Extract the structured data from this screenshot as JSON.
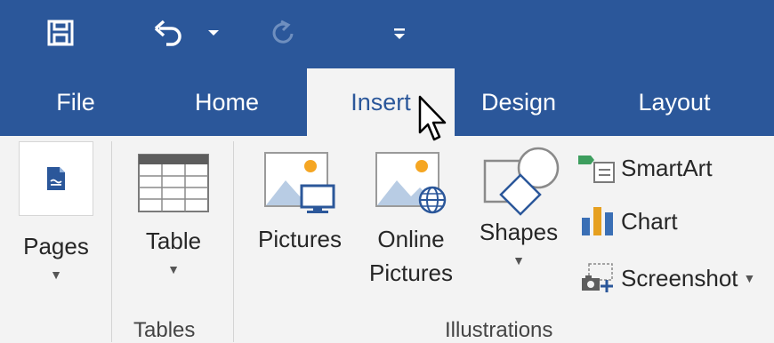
{
  "quick_access": {
    "save_icon": "save-icon",
    "undo_icon": "undo-icon",
    "undo_dropdown_icon": "chevron-down-icon",
    "redo_icon": "redo-icon",
    "customize_icon": "customize-qat-icon"
  },
  "tabs": [
    {
      "label": "File"
    },
    {
      "label": "Home"
    },
    {
      "label": "Insert"
    },
    {
      "label": "Design"
    },
    {
      "label": "Layout"
    }
  ],
  "ribbon": {
    "pages": {
      "label": "Pages"
    },
    "table": {
      "label": "Table"
    },
    "pictures": {
      "label": "Pictures"
    },
    "online_pictures": {
      "line1": "Online",
      "line2": "Pictures"
    },
    "shapes": {
      "label": "Shapes"
    },
    "smartart": {
      "label": "SmartArt"
    },
    "chart": {
      "label": "Chart"
    },
    "screenshot": {
      "label": "Screenshot"
    }
  },
  "groups": {
    "tables": "Tables",
    "illustrations": "Illustrations"
  },
  "colors": {
    "accent": "#2b579a",
    "ribbon_bg": "#f3f3f3",
    "chart_orange": "#e6a020",
    "chart_blue": "#3a6fb5",
    "smartart_green": "#3d9e5e"
  }
}
